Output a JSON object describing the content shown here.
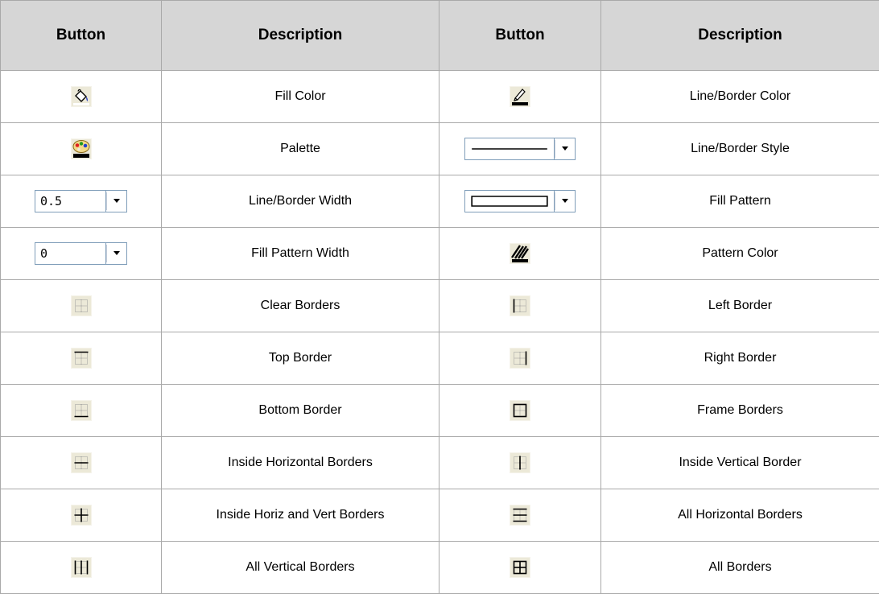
{
  "table": {
    "headers": [
      "Button",
      "Description",
      "Button",
      "Description"
    ],
    "rows": [
      [
        {
          "icon": "fill-color-icon",
          "desc": "Fill Color"
        },
        {
          "icon": "line-border-color-icon",
          "desc": "Line/Border Color"
        }
      ],
      [
        {
          "icon": "palette-icon",
          "desc": "Palette"
        },
        {
          "icon": "line-style-dropdown",
          "desc": "Line/Border Style"
        }
      ],
      [
        {
          "icon": "line-width-dropdown",
          "value": "0.5",
          "desc": "Line/Border Width"
        },
        {
          "icon": "fill-pattern-dropdown",
          "desc": "Fill Pattern"
        }
      ],
      [
        {
          "icon": "pattern-width-dropdown",
          "value": "0",
          "desc": "Fill Pattern Width"
        },
        {
          "icon": "pattern-color-icon",
          "desc": "Pattern Color"
        }
      ],
      [
        {
          "icon": "clear-borders-icon",
          "desc": "Clear Borders"
        },
        {
          "icon": "left-border-icon",
          "desc": "Left Border"
        }
      ],
      [
        {
          "icon": "top-border-icon",
          "desc": "Top Border"
        },
        {
          "icon": "right-border-icon",
          "desc": "Right Border"
        }
      ],
      [
        {
          "icon": "bottom-border-icon",
          "desc": "Bottom Border"
        },
        {
          "icon": "frame-borders-icon",
          "desc": "Frame Borders"
        }
      ],
      [
        {
          "icon": "inside-horizontal-borders-icon",
          "desc": "Inside Horizontal Borders"
        },
        {
          "icon": "inside-vertical-border-icon",
          "desc": "Inside Vertical Border"
        }
      ],
      [
        {
          "icon": "inside-horiz-vert-borders-icon",
          "desc": "Inside Horiz and Vert Borders"
        },
        {
          "icon": "all-horizontal-borders-icon",
          "desc": "All Horizontal Borders"
        }
      ],
      [
        {
          "icon": "all-vertical-borders-icon",
          "desc": "All Vertical Borders"
        },
        {
          "icon": "all-borders-icon",
          "desc": "All Borders"
        }
      ]
    ]
  },
  "colors": {
    "header_bg": "#d6d6d6",
    "grid_line": "#a9a9a9",
    "button_face": "#ece9d8",
    "dropdown_border": "#7f9db9"
  }
}
